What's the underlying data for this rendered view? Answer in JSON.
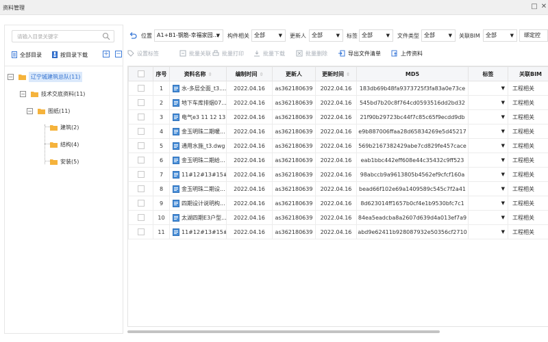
{
  "window": {
    "title": "资料管理",
    "maximize_glyph": "□",
    "close_glyph": "✕"
  },
  "sidebar": {
    "search_placeholder": "请输入目录关键字",
    "all_dirs_label": "全部目录",
    "by_dir_download_label": "按目录下载",
    "expand_all_glyph": "+",
    "collapse_all_glyph": "−",
    "tree": [
      {
        "label": "辽宁城建筑总队(11)",
        "level": 0,
        "selected": true,
        "expander": "−"
      },
      {
        "label": "技术交底资料(11)",
        "level": 1,
        "selected": false,
        "expander": "−"
      },
      {
        "label": "图纸(11)",
        "level": 2,
        "selected": false,
        "expander": "−"
      },
      {
        "label": "建筑(2)",
        "level": 3,
        "selected": false
      },
      {
        "label": "结构(4)",
        "level": 3,
        "selected": false
      },
      {
        "label": "安装(5)",
        "level": 3,
        "selected": false
      }
    ]
  },
  "filters": {
    "position_label": "位置",
    "position_value": "A1+B1-钢筋-幸福家园...",
    "component_label": "构件相关",
    "component_value": "全部",
    "updater_label": "更新人",
    "updater_value": "全部",
    "tag_label": "标签",
    "tag_value": "全部",
    "filetype_label": "文件类型",
    "filetype_value": "全部",
    "bim_label": "关联BIM",
    "bim_value": "全部",
    "bind_label": "绑定控"
  },
  "actions": {
    "set_tag": "设置标签",
    "batch_link": "批量关联",
    "batch_print": "批量打印",
    "batch_download": "批量下载",
    "batch_delete": "批量删除",
    "export_list": "导出文件清单",
    "upload": "上传资料"
  },
  "table": {
    "headers": {
      "index": "序号",
      "name": "资料名称",
      "created": "编制时间",
      "updater": "更新人",
      "updated": "更新时间",
      "md5": "MD5",
      "tag": "标签",
      "bim": "关联BIM"
    },
    "rows": [
      {
        "index": "1",
        "name": "水-多层全面_t3....",
        "created": "2022.04.16",
        "updater": "as362180639",
        "updated": "2022.04.16",
        "md5": "183db69b48fa9373725f3fa83a0e73ce",
        "bim": "工程相关"
      },
      {
        "index": "2",
        "name": "地下车库排烟07...",
        "created": "2022.04.16",
        "updater": "as362180639",
        "updated": "2022.04.16",
        "md5": "545bd7b20c8f764cd0593516dd2bd32",
        "bim": "工程相关"
      },
      {
        "index": "3",
        "name": "电气e3 11 12 13...",
        "created": "2022.04.16",
        "updater": "as362180639",
        "updated": "2022.04.16",
        "md5": "21f90b29723bc44f7c85c65f9ecdd9db",
        "bim": "工程相关"
      },
      {
        "index": "4",
        "name": "金玉明珠二期暖...",
        "created": "2022.04.16",
        "updater": "as362180639",
        "updated": "2022.04.16",
        "md5": "e9b887006ffaa28d65834269e5d45217",
        "bim": "工程相关"
      },
      {
        "index": "5",
        "name": "通用水施_t3.dwg",
        "created": "2022.04.16",
        "updater": "as362180639",
        "updated": "2022.04.16",
        "md5": "569b2167382429abe7cd829fe457cace",
        "bim": "工程相关"
      },
      {
        "index": "6",
        "name": "金玉明珠二期给...",
        "created": "2022.04.16",
        "updater": "as362180639",
        "updated": "2022.04.16",
        "md5": "eab1bbc442eff608e44c35432c9ff523",
        "bim": "工程相关"
      },
      {
        "index": "7",
        "name": "11#12#13#15# ...",
        "created": "2022.04.16",
        "updater": "as362180639",
        "updated": "2022.04.16",
        "md5": "98abccb9a9613805b4562ef9cfcf160a",
        "bim": "工程相关"
      },
      {
        "index": "8",
        "name": "金玉明珠二期设...",
        "created": "2022.04.16",
        "updater": "as362180639",
        "updated": "2022.04.16",
        "md5": "bead66f102e69a1409589c545c7f2a41",
        "bim": "工程相关"
      },
      {
        "index": "9",
        "name": "四期设计说明构...",
        "created": "2022.04.16",
        "updater": "as362180639",
        "updated": "2022.04.16",
        "md5": "8d623014ff1657b0cf4e1b9530bfc7c1",
        "bim": "工程相关"
      },
      {
        "index": "10",
        "name": "太湖四期E3户型...",
        "created": "2022.04.16",
        "updater": "as362180639",
        "updated": "2022.04.16",
        "md5": "84ea5eadcba8a2607d639d4a013ef7a9",
        "bim": "工程相关"
      },
      {
        "index": "11",
        "name": "11#12#13#15#...",
        "created": "2022.04.16",
        "updater": "as362180639",
        "updated": "2022.04.16",
        "md5": "abd9e62411b928087932e50356cf2710",
        "bim": "工程相关"
      }
    ]
  },
  "colors": {
    "accent": "#3b7ad8",
    "folder": "#f5b33c",
    "selected_bg": "#dbe9fb",
    "disabled_text": "#aab0b8"
  },
  "icons": {
    "search": "search-icon",
    "back": "refresh-back-icon",
    "file": "dwg-file-icon",
    "folder": "folder-icon"
  }
}
